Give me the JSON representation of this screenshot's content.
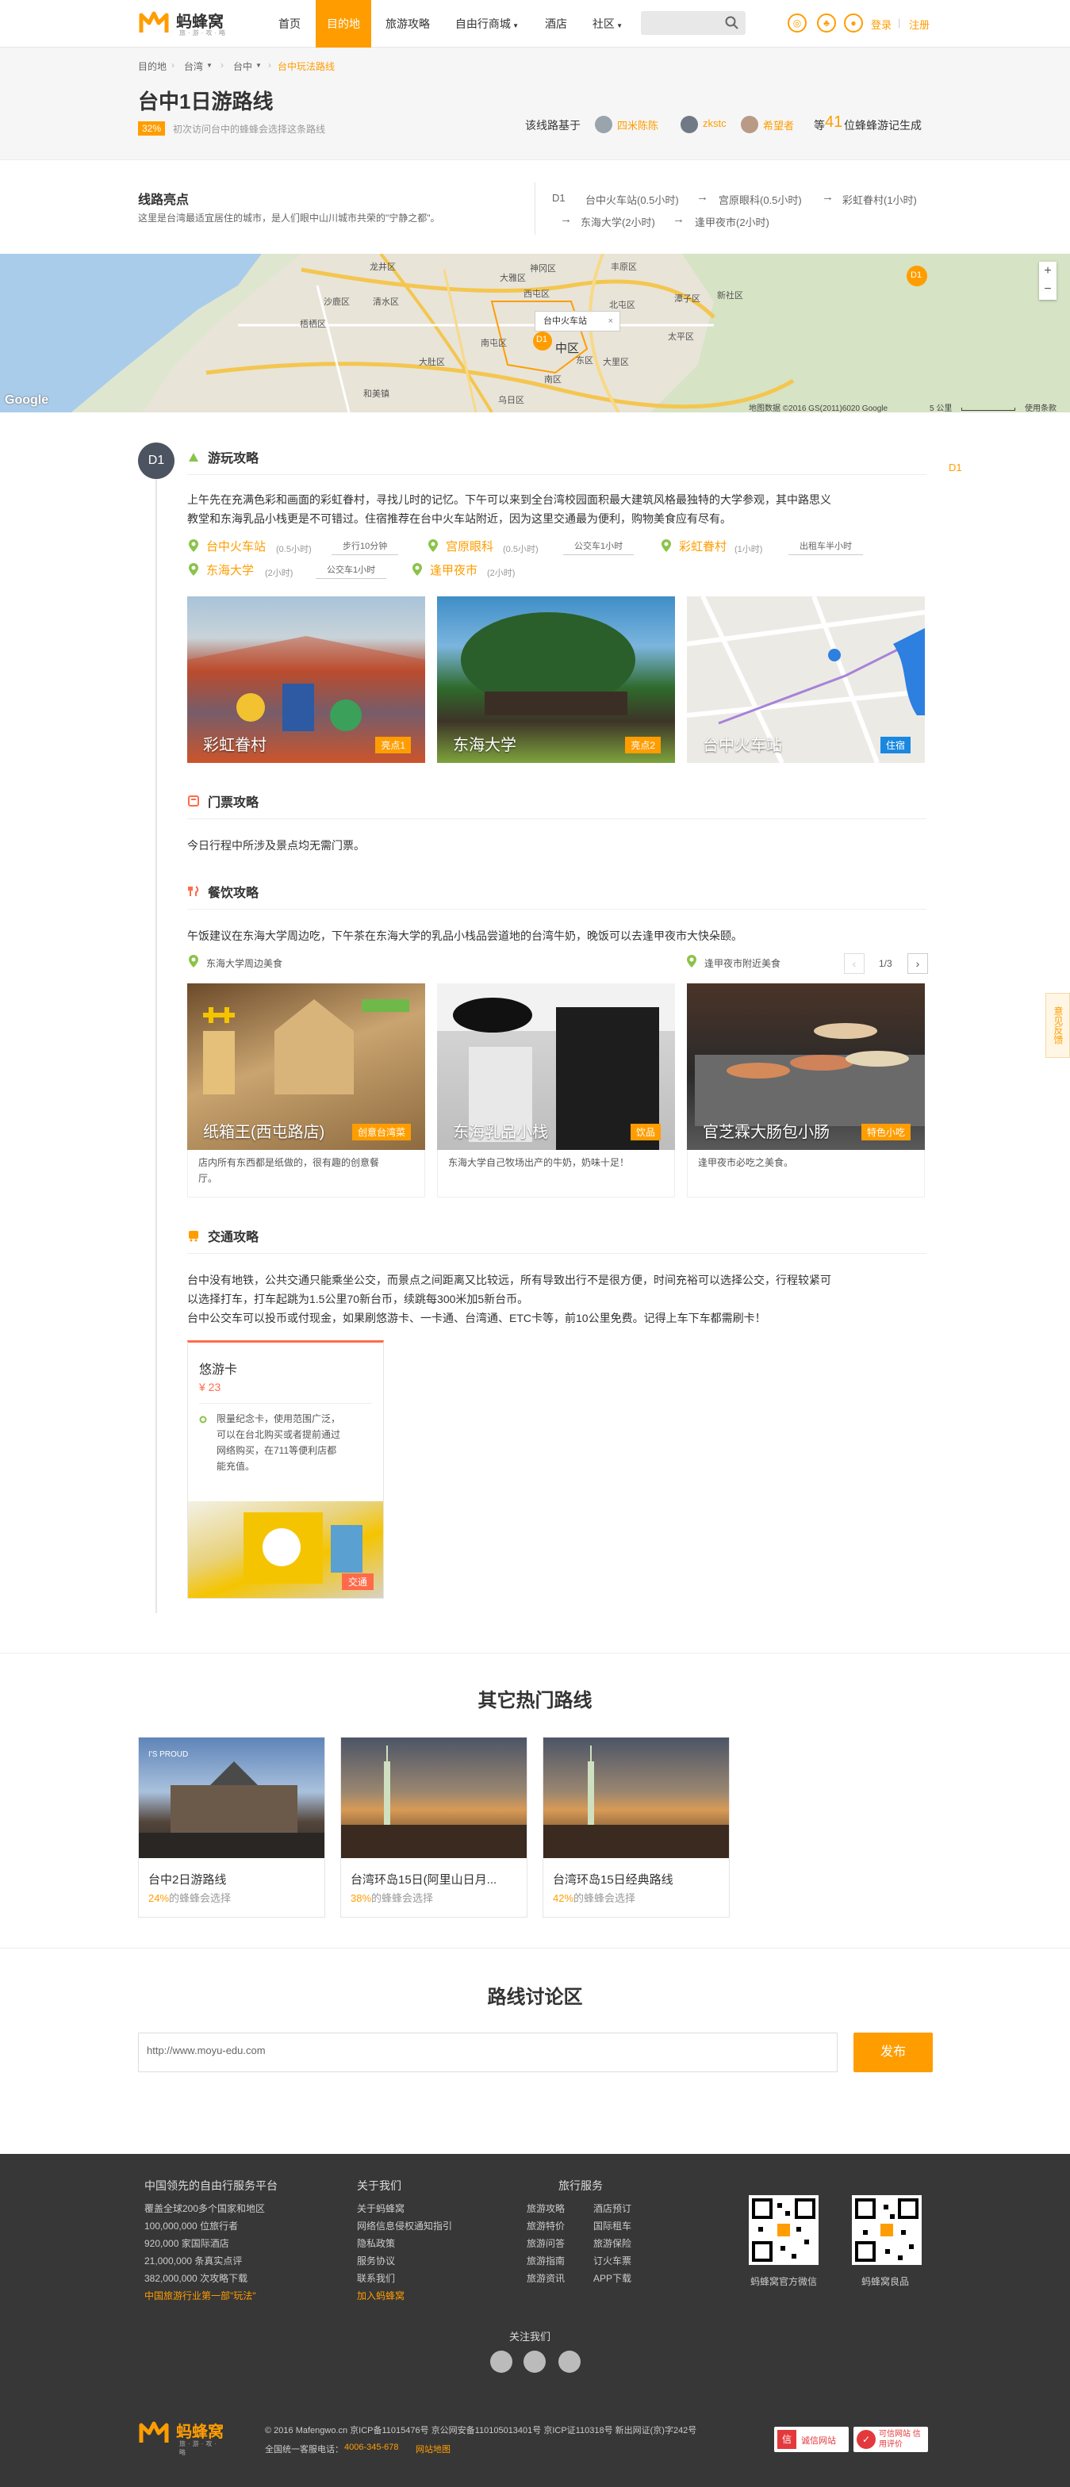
{
  "header": {
    "logo_text": "蚂蜂窝",
    "logo_sub": "旅·游·攻·略",
    "nav": [
      "首页",
      "目的地",
      "旅游攻略",
      "自由行商城",
      "酒店",
      "社区"
    ],
    "login": "登录",
    "register": "注册"
  },
  "breadcrumb": [
    "目的地",
    "台湾",
    "台中",
    "台中玩法路线"
  ],
  "page": {
    "title": "台中1日游路线",
    "pct": "32%",
    "pct_text": "初次访问台中的蜂蜂会选择这条路线",
    "gen_prefix": "该线路基于",
    "users": [
      "四米陈陈",
      "zkstc",
      "希望者"
    ],
    "gen_suffix_pre": "等",
    "gen_count": "41",
    "gen_suffix": "位蜂蜂游记生成"
  },
  "highlights": {
    "title": "线路亮点",
    "desc": "这里是台湾最适宜居住的城市，是人们眼中山川城市共荣的\"宁静之都\"。",
    "day": "D1",
    "route": [
      "台中火车站(0.5小时)",
      "宫原眼科(0.5小时)",
      "彩虹眷村(1小时)",
      "东海大学(2小时)",
      "逢甲夜市(2小时)"
    ]
  },
  "map": {
    "tooltip": "台中火车站",
    "marker": "D1",
    "credit": "地图数据 ©2016 GS(2011)6020 Google",
    "scale": "5 公里",
    "terms": "使用条款",
    "brand": "Google",
    "places": [
      "龙井区",
      "沙鹿区",
      "梧栖区",
      "西屯区",
      "北屯区",
      "中区",
      "南区",
      "大肚区",
      "乌日区",
      "大里区",
      "太平区",
      "潭子区",
      "新社区",
      "清水区",
      "大雅区",
      "神冈区",
      "丰原区",
      "东区",
      "和美镇",
      "南屯区"
    ]
  },
  "day": {
    "badge": "D1",
    "side_label": "D1",
    "play": {
      "title": "游玩攻略",
      "text1": "上午先在充满色彩和画面的彩虹眷村，寻找儿时的记忆。下午可以来到全台湾校园面积最大建筑风格最独特的大学参观，其中路思义",
      "text2": "教堂和东海乳品小栈更是不可错过。住宿推荐在台中火车站附近，因为这里交通最为便利，购物美食应有尽有。",
      "pois": [
        {
          "name": "台中火车站",
          "time": "(0.5小时)"
        },
        {
          "name": "宫原眼科",
          "time": "(0.5小时)"
        },
        {
          "name": "彩虹眷村",
          "time": "(1小时)"
        },
        {
          "name": "东海大学",
          "time": "(2小时)"
        },
        {
          "name": "逢甲夜市",
          "time": "(2小时)"
        }
      ],
      "transit": [
        "步行10分钟",
        "公交车1小时",
        "出租车半小时",
        "公交车1小时"
      ],
      "photos": [
        {
          "name": "彩虹眷村",
          "tag": "亮点1"
        },
        {
          "name": "东海大学",
          "tag": "亮点2"
        },
        {
          "name": "台中火车站",
          "tag": "住宿"
        }
      ]
    },
    "ticket": {
      "title": "门票攻略",
      "text": "今日行程中所涉及景点均无需门票。"
    },
    "food": {
      "title": "餐饮攻略",
      "text": "午饭建议在东海大学周边吃，下午茶在东海大学的乳品小栈品尝道地的台湾牛奶，晚饭可以去逢甲夜市大快朵颐。",
      "loc1": "东海大学周边美食",
      "loc2": "逢甲夜市附近美食",
      "pager": "1/3",
      "cards": [
        {
          "name": "纸箱王(西屯路店)",
          "tag": "创意台湾菜",
          "desc1": "店内所有东西都是纸做的，很有趣的创意餐",
          "desc2": "厅。"
        },
        {
          "name": "东海乳品小栈",
          "tag": "饮品",
          "desc1": "东海大学自己牧场出产的牛奶，奶味十足！",
          "desc2": ""
        },
        {
          "name": "官芝霖大肠包小肠",
          "tag": "特色小吃",
          "desc1": "逢甲夜市必吃之美食。",
          "desc2": ""
        }
      ]
    },
    "traffic": {
      "title": "交通攻略",
      "text1": "台中没有地铁，公共交通只能乘坐公交，而景点之间距离又比较远，所有导致出行不是很方便，时间充裕可以选择公交，行程较紧可",
      "text2": "以选择打车，打车起跳为1.5公里70新台币，续跳每300米加5新台币。",
      "text3": "台中公交车可以投币或付现金，如果刷悠游卡、一卡通、台湾通、ETC卡等，前10公里免费。记得上车下车都需刷卡！",
      "card": {
        "name": "悠游卡",
        "price": "¥ 23",
        "desc": [
          "限量纪念卡，使用范围广泛，",
          "可以在台北购买或者提前通过",
          "网络购买，在711等便利店都",
          "能充值。"
        ],
        "tag": "交通"
      }
    }
  },
  "side_tab": "意见反馈",
  "other": {
    "title": "其它热门路线",
    "routes": [
      {
        "name": "台中2日游路线",
        "pct": "24%",
        "suffix": "的蜂蜂会选择"
      },
      {
        "name": "台湾环岛15日(阿里山日月...",
        "pct": "38%",
        "suffix": "的蜂蜂会选择"
      },
      {
        "name": "台湾环岛15日经典路线",
        "pct": "42%",
        "suffix": "的蜂蜂会选择"
      }
    ]
  },
  "discussion": {
    "title": "路线讨论区",
    "placeholder": "http://www.moyu-edu.com",
    "button": "发布"
  },
  "footer": {
    "col1_title": "中国领先的自由行服务平台",
    "col1": [
      "覆盖全球200多个国家和地区",
      "100,000,000 位旅行者",
      "920,000 家国际酒店",
      "21,000,000 条真实点评",
      "382,000,000 次攻略下载",
      "中国旅游行业第一部\"玩法\""
    ],
    "col2_title": "关于我们",
    "col2": [
      "关于蚂蜂窝",
      "网络信息侵权通知指引",
      "隐私政策",
      "服务协议",
      "联系我们",
      "加入蚂蜂窝"
    ],
    "col3_title": "旅行服务",
    "col3a": [
      "旅游攻略",
      "旅游特价",
      "旅游问答",
      "旅游指南",
      "旅游资讯"
    ],
    "col3b": [
      "酒店预订",
      "国际租车",
      "旅游保险",
      "订火车票",
      "APP下载"
    ],
    "qr1": "蚂蜂窝官方微信",
    "qr2": "蚂蜂窝良品",
    "follow": "关注我们",
    "copyright": "© 2016 Mafengwo.cn 京ICP备11015476号 京公网安备11010501340​1号 京ICP证110318号 新出网证(京)字242号",
    "hotline_label": "全国统一客服电话：",
    "hotline": "4006-345-678",
    "hotline_link": "网站地图",
    "badge1": "诚信网站",
    "badge2": "可信网站 信用评价"
  }
}
